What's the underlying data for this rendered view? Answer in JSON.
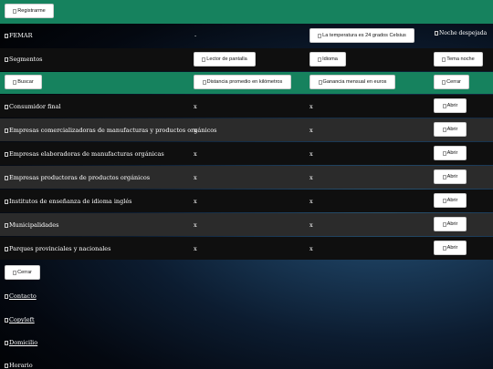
{
  "header": {
    "register_label": "Registrarme"
  },
  "info_row": {
    "logo_alt": "FEMAR",
    "dash": "-",
    "temperature_label": "La temperatura es 24 grados Celsius",
    "weather_alt": "Noche despejada"
  },
  "segments_row": {
    "label": "Segmentos",
    "screen_reader_label": "Lector de pantalla",
    "language_label": "Idioma",
    "night_theme_label": "Tema noche"
  },
  "search_row": {
    "search_label": "Buscar",
    "distance_label": "Distancia promedio en kilómetros",
    "income_label": "Ganancia mensual en euros",
    "close_label": "Cerrar"
  },
  "segments": [
    {
      "name": "Consumidor final",
      "distance": "x",
      "income": "x",
      "open_label": "Abrir"
    },
    {
      "name": "Empresas comercializadoras de manufacturas y productos orgánicos",
      "distance": "x",
      "income": "x",
      "open_label": "Abrir"
    },
    {
      "name": "Empresas elaboradoras de manufacturas orgánicas",
      "distance": "x",
      "income": "x",
      "open_label": "Abrir"
    },
    {
      "name": "Empresas productoras de productos orgánicos",
      "distance": "x",
      "income": "x",
      "open_label": "Abrir"
    },
    {
      "name": "Institutos de enseñanza de idioma inglés",
      "distance": "x",
      "income": "x",
      "open_label": "Abrir"
    },
    {
      "name": "Municipalidades",
      "distance": "x",
      "income": "x",
      "open_label": "Abrir"
    },
    {
      "name": "Parques provinciales y nacionales",
      "distance": "x",
      "income": "x",
      "open_label": "Abrir"
    }
  ],
  "footer": {
    "close_label": "Cerrar",
    "links": [
      "Contacto",
      "Copyleft",
      "Domicilio",
      "Horario"
    ]
  },
  "colors": {
    "accent": "#16825e",
    "row_dark": "#0f0f0f",
    "row_mid": "#2b2b2b"
  }
}
